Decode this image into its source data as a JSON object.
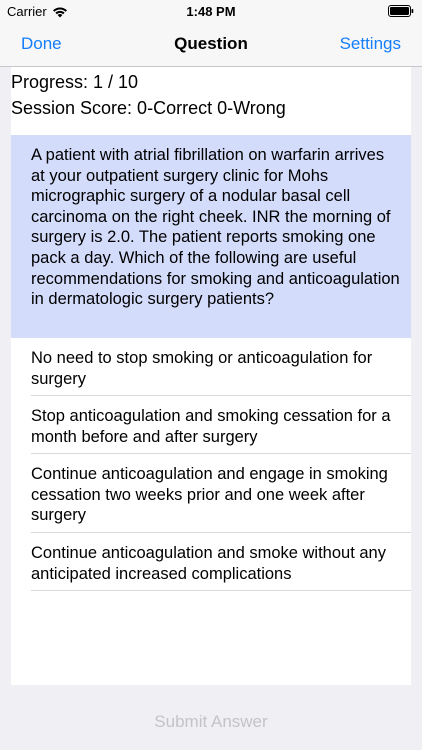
{
  "status_bar": {
    "carrier": "Carrier",
    "time": "1:48 PM"
  },
  "nav": {
    "left_label": "Done",
    "title": "Question",
    "right_label": "Settings"
  },
  "stats": {
    "progress": "Progress: 1 / 10",
    "score": "Session Score: 0-Correct 0-Wrong"
  },
  "question": {
    "text": "A patient with atrial fibrillation on warfarin arrives at your outpatient surgery clinic for Mohs micrographic surgery of a nodular basal cell carcinoma on the right cheek.  INR the morning of surgery is 2.0.  The patient reports smoking one pack a day.  Which of the following are useful recommendations for smoking and anticoagulation in dermatologic surgery patients?"
  },
  "answers": [
    {
      "text": "No need to stop smoking or anticoagulation for surgery"
    },
    {
      "text": "Stop anticoagulation and smoking cessation for a month before and after surgery"
    },
    {
      "text": "Continue anticoagulation and engage in smoking cessation two weeks prior and one week after surgery"
    },
    {
      "text": "Continue anticoagulation and smoke without any anticipated increased complications"
    }
  ],
  "submit_label": "Submit Answer",
  "colors": {
    "accent": "#147efb",
    "question_bg": "#d4dcfb",
    "disabled_text": "#c4c4c8"
  },
  "icons": {
    "wifi": "wifi-icon",
    "battery": "battery-icon"
  }
}
